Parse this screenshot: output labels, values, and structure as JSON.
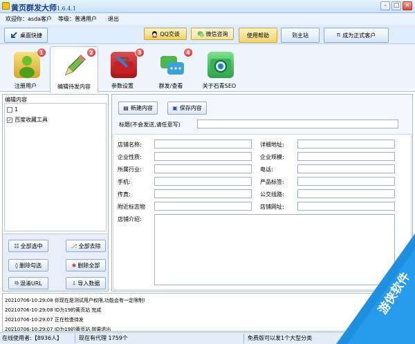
{
  "window": {
    "title": "黄页群发大师",
    "version": "1.6.4.1"
  },
  "menu": {
    "welcome": "欢迎你：asda客户",
    "level": "等级：普通用户",
    "logout": "退出"
  },
  "toolbar": {
    "desktop": "桌面快捷",
    "qq": "QQ交谈",
    "wechat": "微信咨询",
    "help": "使用帮助",
    "main_site": "到主站",
    "upgrade": "成为正式客户"
  },
  "tabs": [
    {
      "label": "注册用户",
      "badge": "1"
    },
    {
      "label": "编辑待发内容",
      "badge": "2"
    },
    {
      "label": "参数设置",
      "badge": "3"
    },
    {
      "label": "群发/查看",
      "badge": "4"
    },
    {
      "label": "关于石青SEO",
      "badge": ""
    }
  ],
  "left": {
    "header": "编辑内容",
    "items": [
      {
        "label": "1",
        "checked": false
      },
      {
        "label": "百度收藏工具",
        "checked": true
      }
    ],
    "buttons": {
      "select_all": "全部选中",
      "deselect_all": "全部去除",
      "delete_checked": "删除勾选",
      "delete_all": "删除全部",
      "obfuscate_url": "混淆URL",
      "import_data": "导入数据"
    }
  },
  "right": {
    "new_content": "新建内容",
    "save_content": "保存内容",
    "title_label": "标题(不会发送,请任意写)",
    "title_value": "",
    "fields_left": [
      "店铺名称:",
      "企业性质:",
      "所属行业:",
      "手机:",
      "传真:",
      "附近标志物",
      "店铺介绍:"
    ],
    "fields_right": [
      "详细地址:",
      "企业规模:",
      "电话:",
      "产品标签:",
      "公交线路:",
      "店铺网址:"
    ]
  },
  "log": [
    "20210706-10:29:08  你现在是测试用户权限,功能会有一定限制!",
    "20210706-10:29:08  ID为19的黄页站 完成",
    "20210706-10:29:07  正在检查待发",
    "20210706-10:29:07  ID为19的黄页站 效果退出"
  ],
  "status": {
    "online": "在线使用者:【8936人】",
    "proxy": "现在有代理 1759个",
    "free": "免费版可以发1个大型分类"
  },
  "watermark": {
    "text": "游侠软件"
  },
  "colors": {
    "accent": "#1b3f80",
    "badge": "#d21010",
    "watermark": "#1f8fe0"
  }
}
